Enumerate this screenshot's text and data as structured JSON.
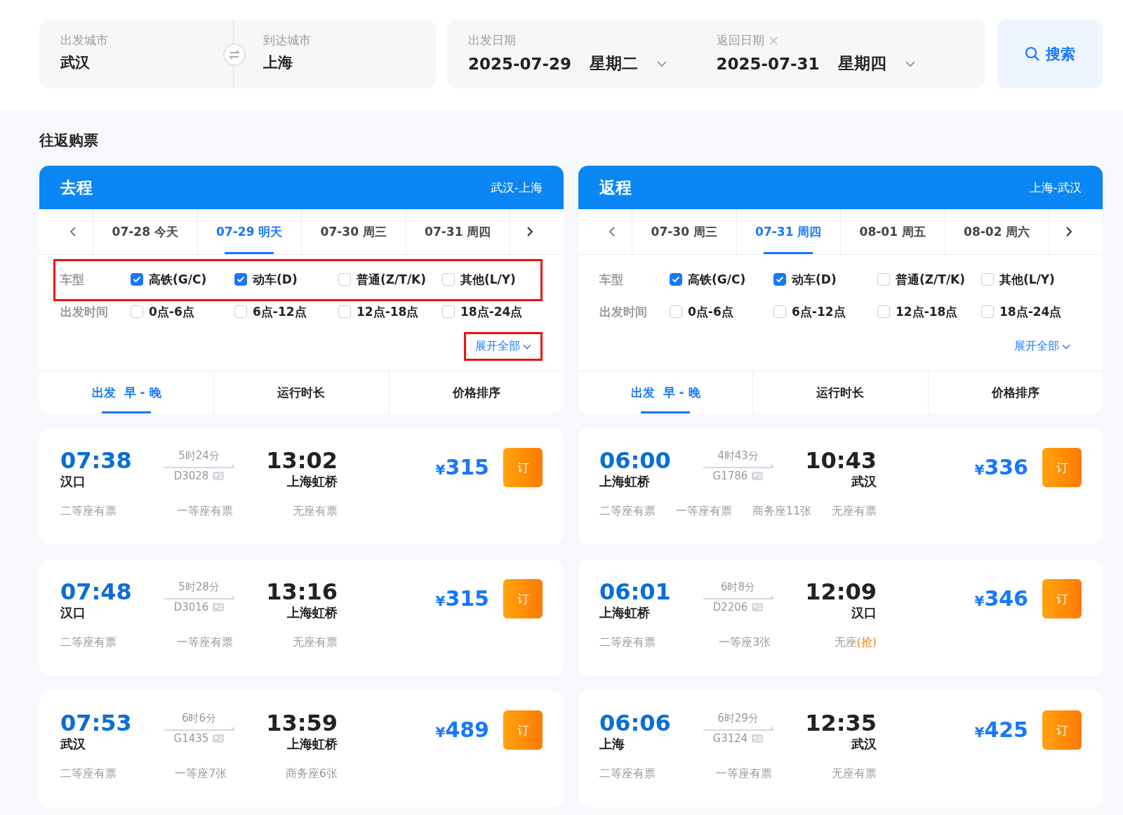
{
  "search": {
    "from_label": "出发城市",
    "from": "武汉",
    "to_label": "到达城市",
    "to": "上海",
    "depart_label": "出发日期",
    "depart_date": "2025-07-29",
    "depart_weekday": "星期二",
    "return_label": "返回日期",
    "return_date": "2025-07-31",
    "return_weekday": "星期四",
    "button": "搜索"
  },
  "section_title": "往返购票",
  "panels": [
    {
      "title": "去程",
      "route": "武汉-上海",
      "dates": [
        {
          "label": "07-28 今天",
          "selected": false
        },
        {
          "label": "07-29 明天",
          "selected": true
        },
        {
          "label": "07-30 周三",
          "selected": false
        },
        {
          "label": "07-31 周四",
          "selected": false
        }
      ],
      "filters": [
        {
          "label": "车型",
          "highlighted": true,
          "options": [
            {
              "label": "高铁(G/C)",
              "checked": true
            },
            {
              "label": "动车(D)",
              "checked": true
            },
            {
              "label": "普通(Z/T/K)",
              "checked": false
            },
            {
              "label": "其他(L/Y)",
              "checked": false
            }
          ]
        },
        {
          "label": "出发时间",
          "highlighted": false,
          "options": [
            {
              "label": "0点-6点",
              "checked": false
            },
            {
              "label": "6点-12点",
              "checked": false
            },
            {
              "label": "12点-18点",
              "checked": false
            },
            {
              "label": "18点-24点",
              "checked": false
            }
          ]
        }
      ],
      "expand": {
        "label": "展开全部",
        "highlighted": true
      },
      "sorts": [
        {
          "label": "出发  早 - 晚",
          "selected": true
        },
        {
          "label": "运行时长",
          "selected": false
        },
        {
          "label": "价格排序",
          "selected": false
        }
      ],
      "trains": [
        {
          "depart_time": "07:38",
          "depart_station": "汉口",
          "duration": "5时24分",
          "number": "D3028",
          "arrive_time": "13:02",
          "arrive_station": "上海虹桥",
          "currency": "¥",
          "price": "315",
          "book": "订",
          "seats": [
            {
              "text": "二等座有票"
            },
            {
              "text": "一等座有票"
            },
            {
              "text": "无座有票"
            }
          ]
        },
        {
          "depart_time": "07:48",
          "depart_station": "汉口",
          "duration": "5时28分",
          "number": "D3016",
          "arrive_time": "13:16",
          "arrive_station": "上海虹桥",
          "currency": "¥",
          "price": "315",
          "book": "订",
          "seats": [
            {
              "text": "二等座有票"
            },
            {
              "text": "一等座有票"
            },
            {
              "text": "无座有票"
            }
          ]
        },
        {
          "depart_time": "07:53",
          "depart_station": "武汉",
          "duration": "6时6分",
          "number": "G1435",
          "arrive_time": "13:59",
          "arrive_station": "上海虹桥",
          "currency": "¥",
          "price": "489",
          "book": "订",
          "seats": [
            {
              "text": "二等座有票"
            },
            {
              "text": "一等座7张"
            },
            {
              "text": "商务座6张"
            }
          ]
        }
      ]
    },
    {
      "title": "返程",
      "route": "上海-武汉",
      "dates": [
        {
          "label": "07-30 周三",
          "selected": false
        },
        {
          "label": "07-31 周四",
          "selected": true
        },
        {
          "label": "08-01 周五",
          "selected": false
        },
        {
          "label": "08-02 周六",
          "selected": false
        }
      ],
      "filters": [
        {
          "label": "车型",
          "highlighted": false,
          "options": [
            {
              "label": "高铁(G/C)",
              "checked": true
            },
            {
              "label": "动车(D)",
              "checked": true
            },
            {
              "label": "普通(Z/T/K)",
              "checked": false
            },
            {
              "label": "其他(L/Y)",
              "checked": false
            }
          ]
        },
        {
          "label": "出发时间",
          "highlighted": false,
          "options": [
            {
              "label": "0点-6点",
              "checked": false
            },
            {
              "label": "6点-12点",
              "checked": false
            },
            {
              "label": "12点-18点",
              "checked": false
            },
            {
              "label": "18点-24点",
              "checked": false
            }
          ]
        }
      ],
      "expand": {
        "label": "展开全部",
        "highlighted": false
      },
      "sorts": [
        {
          "label": "出发  早 - 晚",
          "selected": true
        },
        {
          "label": "运行时长",
          "selected": false
        },
        {
          "label": "价格排序",
          "selected": false
        }
      ],
      "trains": [
        {
          "depart_time": "06:00",
          "depart_station": "上海虹桥",
          "duration": "4时43分",
          "number": "G1786",
          "arrive_time": "10:43",
          "arrive_station": "武汉",
          "currency": "¥",
          "price": "336",
          "book": "订",
          "seats": [
            {
              "text": "二等座有票"
            },
            {
              "text": "一等座有票"
            },
            {
              "text": "商务座11张"
            },
            {
              "text": "无座有票"
            }
          ]
        },
        {
          "depart_time": "06:01",
          "depart_station": "上海虹桥",
          "duration": "6时8分",
          "number": "D2206",
          "arrive_time": "12:09",
          "arrive_station": "汉口",
          "currency": "¥",
          "price": "346",
          "book": "订",
          "seats": [
            {
              "text": "二等座有票"
            },
            {
              "text": "一等座3张"
            },
            {
              "text": "无座",
              "grab": "(抢)"
            }
          ]
        },
        {
          "depart_time": "06:06",
          "depart_station": "上海",
          "duration": "6时29分",
          "number": "G3124",
          "arrive_time": "12:35",
          "arrive_station": "武汉",
          "currency": "¥",
          "price": "425",
          "book": "订",
          "seats": [
            {
              "text": "二等座有票"
            },
            {
              "text": "一等座有票"
            },
            {
              "text": "无座有票"
            }
          ]
        }
      ]
    }
  ]
}
